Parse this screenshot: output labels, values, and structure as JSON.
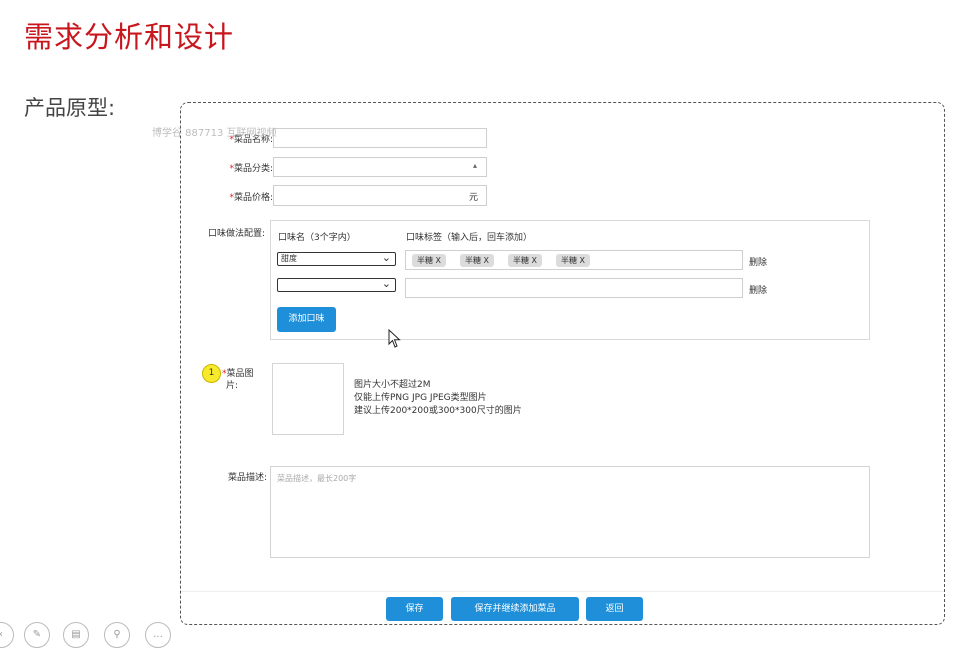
{
  "slide": {
    "title": "需求分析和设计",
    "subtitle": "产品原型:",
    "watermark": "博学谷 887713 互联网视频"
  },
  "form": {
    "name": {
      "req": "*",
      "label": "菜品名称:",
      "value": ""
    },
    "category": {
      "req": "*",
      "label": "菜品分类:",
      "value": "",
      "icon": "updown-icon"
    },
    "price": {
      "req": "*",
      "label": "菜品价格:",
      "value": "",
      "suffix": "元"
    },
    "flavor": {
      "label": "口味做法配置:",
      "col_name": "口味名（3个字内）",
      "col_tags": "口味标签（输入后，回车添加）",
      "rows": [
        {
          "select": "甜度",
          "tags": [
            "半糖  X",
            "半糖  X",
            "半糖  X",
            "半糖  X"
          ],
          "delete": "删除"
        },
        {
          "select": "",
          "tags": [],
          "delete": "删除"
        }
      ],
      "add_button": "添加口味"
    },
    "image": {
      "req": "*",
      "label_line1": "菜品图",
      "label_line2": "片:",
      "hint1": "图片大小不超过2M",
      "hint2": "仅能上传PNG JPG JPEG类型图片",
      "hint3": "建议上传200*200或300*300尺寸的图片"
    },
    "description": {
      "label": "菜品描述:",
      "placeholder": "菜品描述，最长200字"
    },
    "buttons": {
      "save": "保存",
      "save_continue": "保存并继续添加菜品",
      "back": "返回"
    }
  },
  "annotation": {
    "marker": "1"
  },
  "toolbar": {
    "icons": [
      "prev-icon",
      "pen-icon",
      "slides-icon",
      "zoom-icon",
      "more-icon"
    ],
    "more_label": "..."
  }
}
